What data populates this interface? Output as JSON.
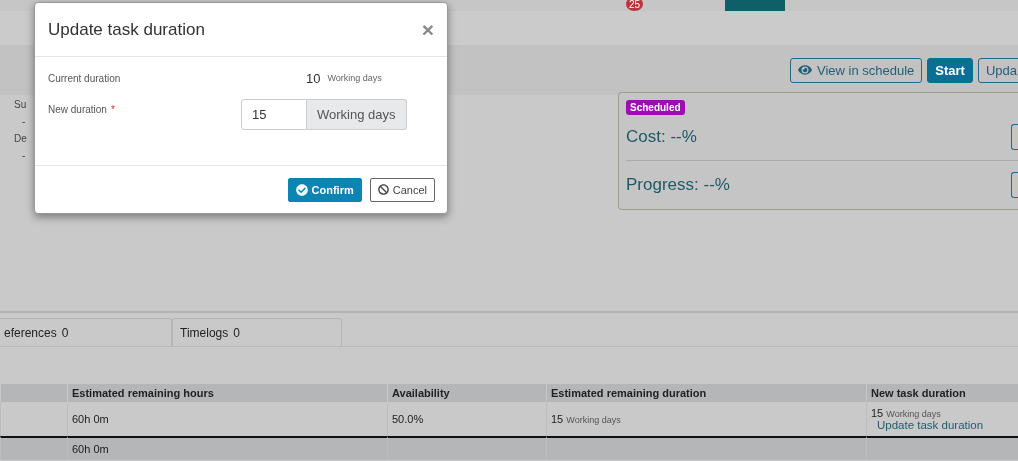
{
  "top_nav": {
    "badge": "25",
    "items": [
      {
        "selected": false
      },
      {
        "selected": true
      },
      {
        "selected": false
      }
    ]
  },
  "toolbar": {
    "buttons": [
      {
        "kind": "outline",
        "label": "View in schedule"
      },
      {
        "kind": "primary",
        "label": "Start"
      },
      {
        "kind": "outline",
        "label": "Upda"
      }
    ]
  },
  "details": {
    "labels": [
      {
        "label": "Su",
        "value": "-"
      },
      {
        "label": "De",
        "value": "-"
      }
    ]
  },
  "status_card": {
    "badge": "Scheduled",
    "metrics": [
      {
        "label": "Cost: --%"
      },
      {
        "label": "Progress: --%"
      }
    ]
  },
  "tabs": [
    {
      "label": "eferences",
      "count": "0",
      "selected": false
    },
    {
      "label": "Timelogs",
      "count": "0",
      "selected": false
    }
  ],
  "table": {
    "columns": [
      {},
      {
        "label": "Estimated remaining hours"
      },
      {
        "label": "Availability"
      },
      {
        "label": "Estimated remaining duration"
      },
      {
        "label": "New task duration"
      }
    ],
    "rows": [
      {
        "total": false,
        "cells": [
          {},
          {
            "text": "60h 0m"
          },
          {
            "text": "50.0%"
          },
          {
            "number": "15",
            "unit": "Working days"
          },
          {
            "number": "15",
            "unit": "Working days",
            "link": "Update task duration"
          }
        ]
      },
      {
        "total": true,
        "cells": [
          {},
          {
            "text": "60h 0m"
          },
          {},
          {},
          {}
        ]
      }
    ]
  },
  "dialog": {
    "title": "Update task duration",
    "close": "×",
    "current_label": "Current duration",
    "current_value": "10",
    "current_unit": "Working days",
    "new_label": "New duration",
    "required": "*",
    "new_value": "15",
    "new_unit": "Working days",
    "buttons": [
      {
        "kind": "primary",
        "label": "Confirm"
      },
      {
        "kind": "secondary",
        "label": "Cancel"
      }
    ]
  }
}
